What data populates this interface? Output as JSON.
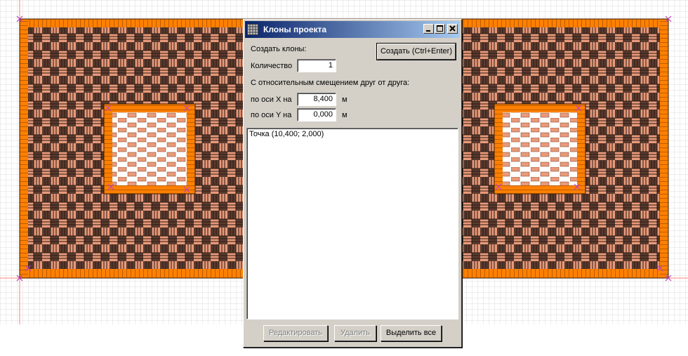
{
  "dialog": {
    "title": "Клоны проекта",
    "create_label": "Создать клоны:",
    "create_button": "Создать (Ctrl+Enter)",
    "quantity_label": "Количество",
    "quantity_value": "1",
    "offset_label": "С относительным смещением друг от друга:",
    "x_label": "по оси X на",
    "x_value": "8,400",
    "x_unit": "м",
    "y_label": "по оси Y на",
    "y_value": "0,000",
    "y_unit": "м",
    "list_items": [
      "Точка (10,400; 2,000)"
    ],
    "edit_button": "Редактировать",
    "delete_button": "Удалить",
    "select_all_button": "Выделить все"
  },
  "colors": {
    "brick_dark": "#5a3a2e",
    "brick_light": "#e89a7a",
    "border_orange": "#ff8000",
    "grid_line": "#d8d8d8",
    "axis_red": "#ff6060",
    "marker": "#c040c0"
  }
}
